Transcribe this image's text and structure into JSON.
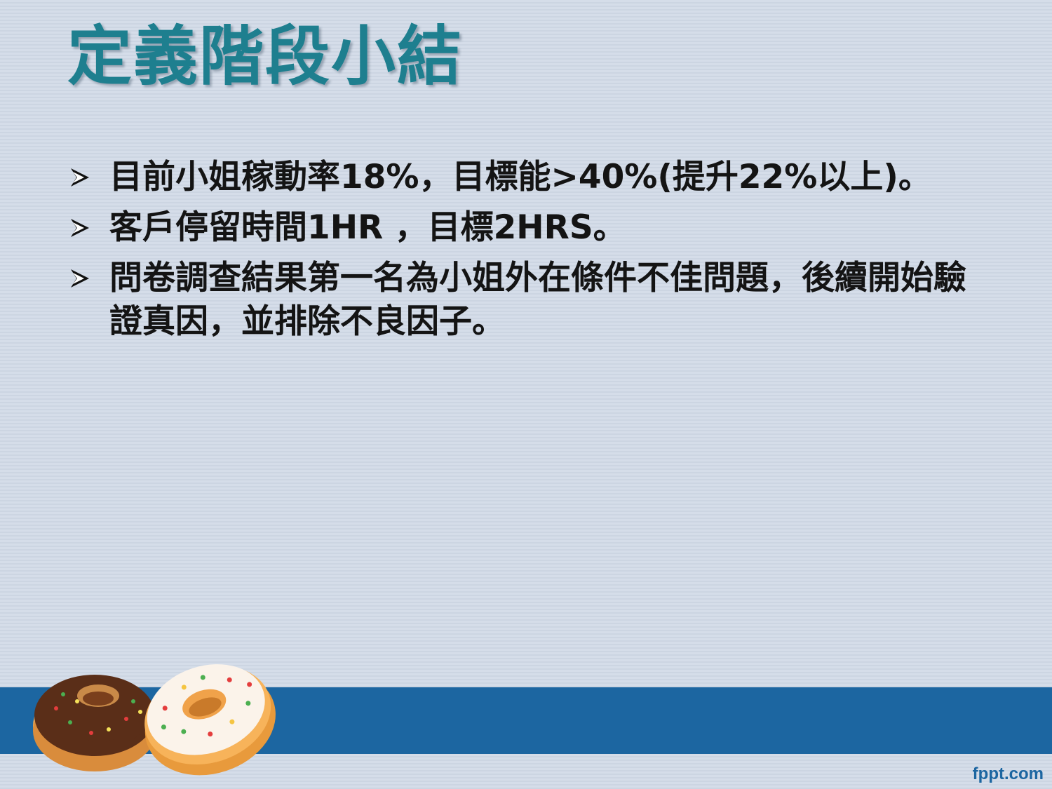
{
  "slide": {
    "title": "定義階段小結",
    "bullets": [
      {
        "text": "目前小姐稼動率18%，目標能>40%(提升22%以上)。"
      },
      {
        "text": "客戶停留時間1HR ，目標2HRS。"
      },
      {
        "text": "問卷調查結果第一名為小姐外在條件不佳問題，後續開始驗證真因，並排除不良因子。"
      }
    ]
  },
  "footer": {
    "brand": "fppt.com"
  },
  "icons": {
    "bullet": "arrow-bullet-icon",
    "decoration": "donuts-illustration"
  },
  "colors": {
    "title": "#1e7f8f",
    "band": "#1c66a1",
    "background": "#d2dbe7"
  }
}
